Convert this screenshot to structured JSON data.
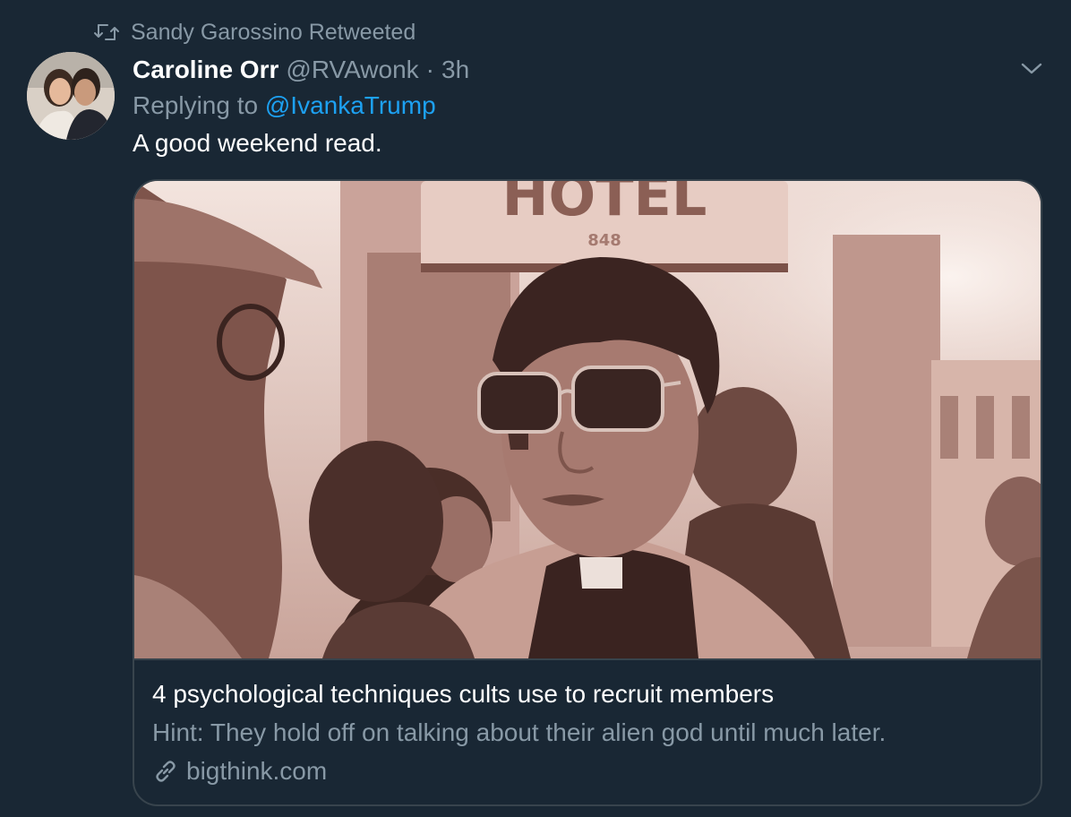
{
  "retweet": {
    "icon": "retweet-icon",
    "label": "Sandy Garossino Retweeted"
  },
  "tweet": {
    "avatar": "avatar",
    "display_name": "Caroline Orr",
    "handle": "@RVAwonk",
    "separator": "·",
    "timestamp": "3h",
    "menu_icon": "chevron-down-icon",
    "replying_prefix": "Replying to",
    "replying_handle": "@IvankaTrump",
    "text": "A good weekend read."
  },
  "card": {
    "image_sign_text": "HOTEL",
    "image_sign_number": "848",
    "title": "4 psychological techniques cults use to recruit members",
    "description": "Hint: They hold off on talking about their alien god until much later.",
    "domain_icon": "link-icon",
    "domain": "bigthink.com"
  },
  "colors": {
    "background": "#192734",
    "secondary_text": "#8899a6",
    "link": "#1da1f2",
    "border": "#38444d",
    "image_tint": "#b98f86"
  }
}
